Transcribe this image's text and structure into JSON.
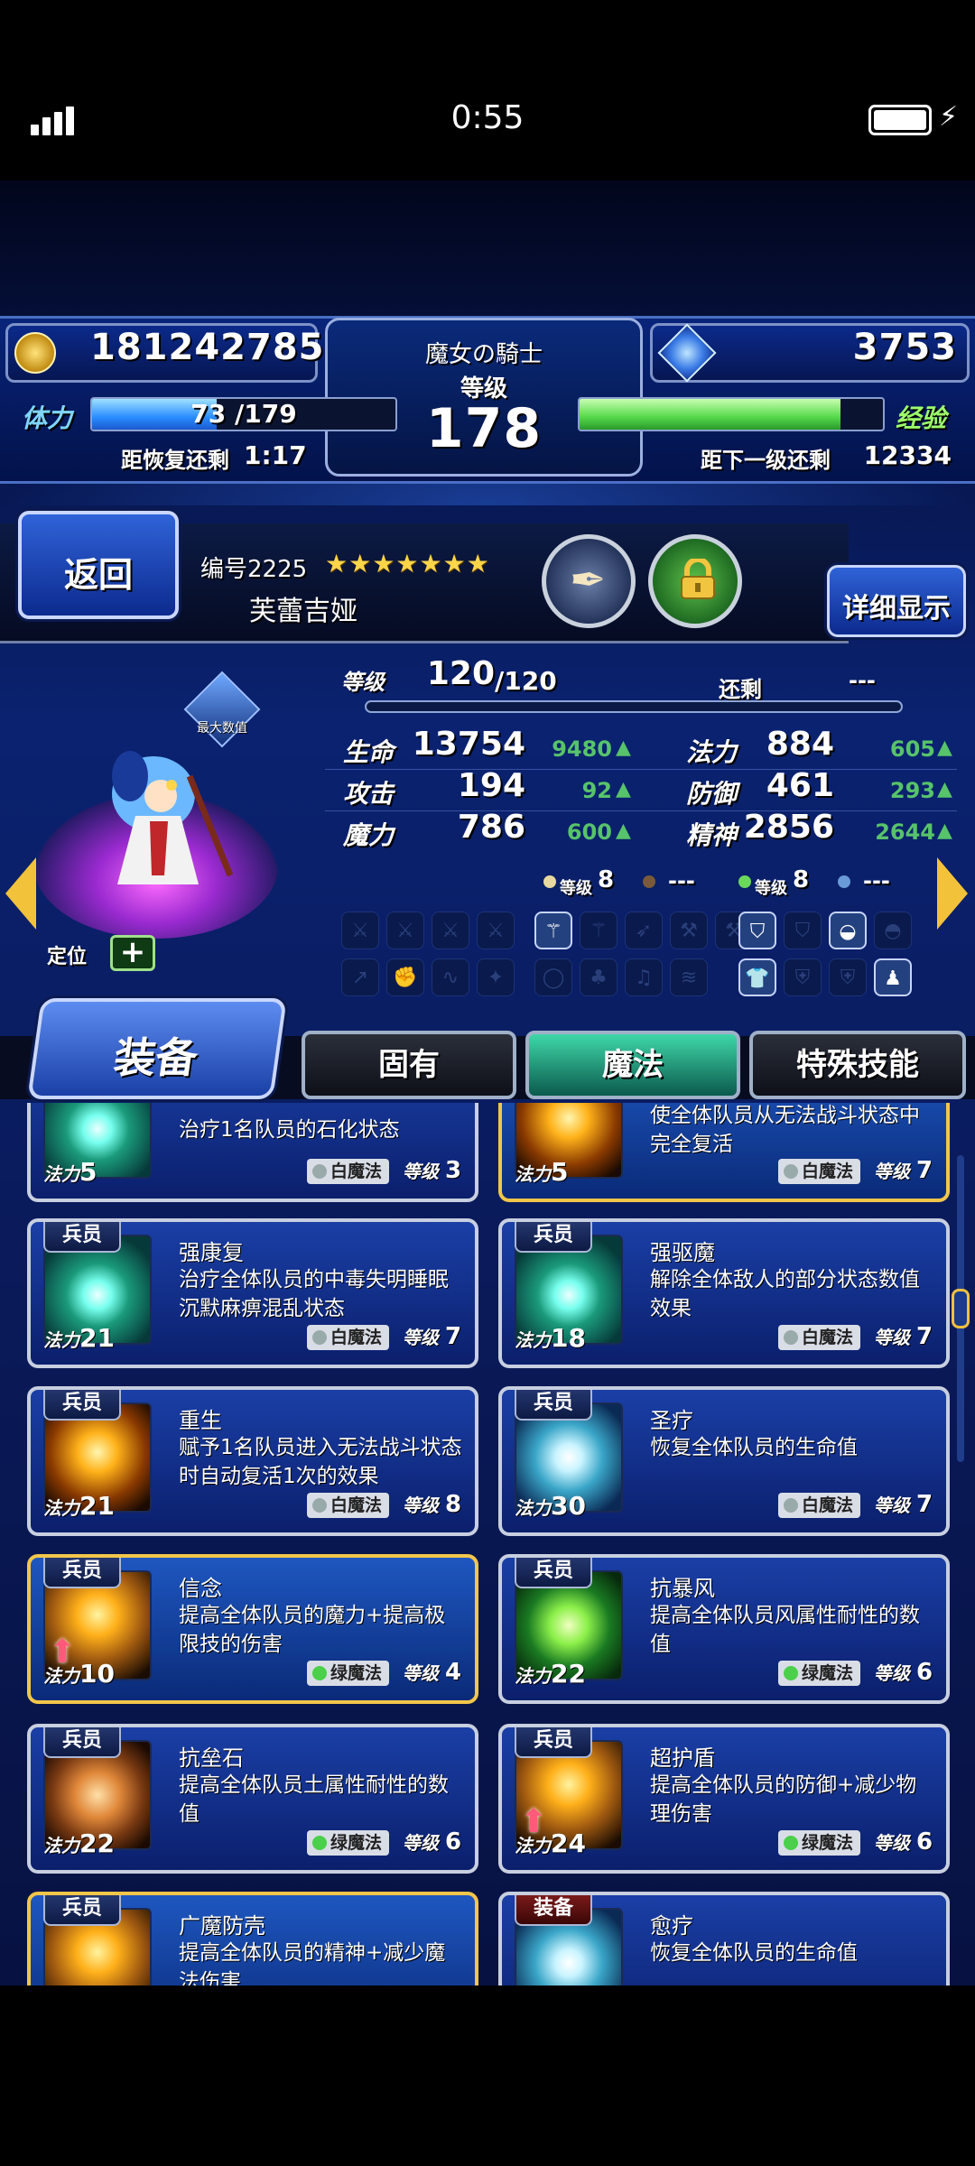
{
  "status_bar": {
    "time": "0:55"
  },
  "hud": {
    "gil": "181242785",
    "title_name": "魔女の騎士",
    "level_label": "等级",
    "level": "178",
    "gems": "3753",
    "stamina_label": "体力",
    "stamina_value": "73 /179",
    "stamina_fraction": 0.41,
    "recover_text": "距恢复还剩",
    "recover_time": "1:17",
    "exp_label": "经验",
    "exp_fraction": 0.86,
    "next_level_text": "距下一级还剩",
    "next_level_value": "12334"
  },
  "unit": {
    "back_label": "返回",
    "id_label": "编号2225",
    "stars": "★★★★★★★",
    "name": "芙蕾吉娅",
    "detail_label": "详细显示",
    "max_badge": "最大数值",
    "position_label": "定位",
    "level_label": "等级",
    "level": "120",
    "level_max": "/120",
    "remaining_label": "还剩",
    "remaining_value": "---"
  },
  "stats": [
    {
      "label": "生命",
      "value": "13754",
      "bonus": "9480"
    },
    {
      "label": "法力",
      "value": "884",
      "bonus": "605"
    },
    {
      "label": "攻击",
      "value": "194",
      "bonus": "92"
    },
    {
      "label": "防御",
      "value": "461",
      "bonus": "293"
    },
    {
      "label": "魔力",
      "value": "786",
      "bonus": "600"
    },
    {
      "label": "精神",
      "value": "2856",
      "bonus": "2644"
    }
  ],
  "enhance": [
    {
      "label": "等级",
      "value": "8"
    },
    {
      "label": "",
      "value": "---"
    },
    {
      "label": "等级",
      "value": "8"
    },
    {
      "label": "",
      "value": "---"
    }
  ],
  "tabs": {
    "equip": "装备",
    "innate": "固有",
    "magic": "魔法",
    "special": "特殊技能"
  },
  "labels": {
    "cost": "法力",
    "level": "等级"
  },
  "cards": [
    {
      "title": "",
      "desc": "治疗1名队员的石化状态",
      "cost": "5",
      "school": "白魔法",
      "level": "3",
      "tag": ""
    },
    {
      "title": "",
      "desc": "使全体队员从无法战斗状态中完全复活",
      "cost": "5",
      "school": "白魔法",
      "level": "7",
      "tag": ""
    },
    {
      "title": "强康复",
      "desc": "治疗全体队员的中毒失明睡眠沉默麻痹混乱状态",
      "cost": "21",
      "school": "白魔法",
      "level": "7",
      "tag": "兵员"
    },
    {
      "title": "强驱魔",
      "desc": "解除全体敌人的部分状态数值效果",
      "cost": "18",
      "school": "白魔法",
      "level": "7",
      "tag": "兵员"
    },
    {
      "title": "重生",
      "desc": "赋予1名队员进入无法战斗状态时自动复活1次的效果",
      "cost": "21",
      "school": "白魔法",
      "level": "8",
      "tag": "兵员"
    },
    {
      "title": "圣疗",
      "desc": "恢复全体队员的生命值",
      "cost": "30",
      "school": "白魔法",
      "level": "7",
      "tag": "兵员"
    },
    {
      "title": "信念",
      "desc": "提高全体队员的魔力+提高极限技的伤害",
      "cost": "10",
      "school": "绿魔法",
      "level": "4",
      "tag": "兵员"
    },
    {
      "title": "抗暴风",
      "desc": "提高全体队员风属性耐性的数值",
      "cost": "22",
      "school": "绿魔法",
      "level": "6",
      "tag": "兵员"
    },
    {
      "title": "抗垒石",
      "desc": "提高全体队员土属性耐性的数值",
      "cost": "22",
      "school": "绿魔法",
      "level": "6",
      "tag": "兵员"
    },
    {
      "title": "超护盾",
      "desc": "提高全体队员的防御+减少物理伤害",
      "cost": "24",
      "school": "绿魔法",
      "level": "6",
      "tag": "兵员"
    },
    {
      "title": "广魔防壳",
      "desc": "提高全体队员的精神+减少魔法伤害",
      "cost": "",
      "school": "",
      "level": "",
      "tag": "兵员"
    },
    {
      "title": "愈疗",
      "desc": "恢复全体队员的生命值",
      "cost": "",
      "school": "",
      "level": "",
      "tag": "装备"
    }
  ]
}
